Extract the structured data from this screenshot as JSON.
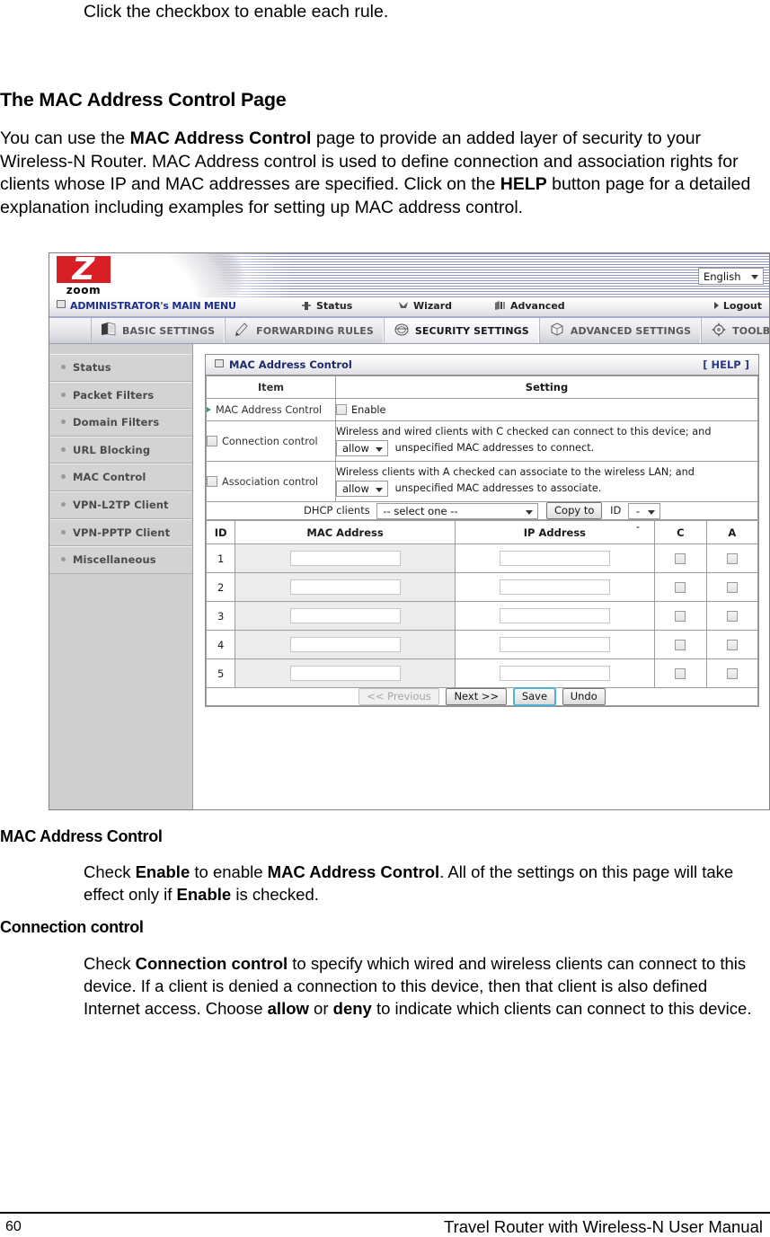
{
  "document": {
    "intro_line": "Click the checkbox to enable each rule.",
    "heading": "The MAC Address Control Page",
    "paragraph_1": "You can use the <b>MAC Address Control</b> page to provide an added layer of security to your Wireless-N Router. MAC Address control is used to define connection and association rights for clients whose IP and MAC addresses are specified. Click on the <b>HELP</b> button page for a detailed explanation including examples for setting up MAC address control.",
    "subheading_1": "MAC Address Control",
    "subparagraph_1": "Check <b>Enable</b> to enable <b>MAC Address Control</b>. All of the settings on this page will take effect only if <b>Enable</b> is checked.",
    "subheading_2": "Connection control",
    "subparagraph_2": "Check <b>Connection control</b> to specify which wired and wireless clients can connect to this device. If a client is denied a connection to this device, then that client is also defined Internet access. Choose <b>allow</b> or <b>deny</b> to indicate which clients can connect to this device.",
    "footer": {
      "page_number": "60",
      "manual_title": "Travel Router with Wireless-N User Manual"
    }
  },
  "router_ui": {
    "brand": {
      "logo_letter": "Z",
      "logo_word": "zoom"
    },
    "language": {
      "selected": "English"
    },
    "main_menu": {
      "admin_label": "ADMINISTRATOR's MAIN MENU",
      "items": [
        {
          "label": "Status",
          "icon": "status-icon"
        },
        {
          "label": "Wizard",
          "icon": "wizard-icon"
        },
        {
          "label": "Advanced",
          "icon": "advanced-icon"
        }
      ],
      "logout_label": "Logout"
    },
    "tabs": [
      {
        "label": "BASIC SETTINGS",
        "icon": "book-icon",
        "active": false
      },
      {
        "label": "FORWARDING RULES",
        "icon": "pencil-icon",
        "active": false
      },
      {
        "label": "SECURITY SETTINGS",
        "icon": "shield-icon",
        "active": true
      },
      {
        "label": "ADVANCED SETTINGS",
        "icon": "cube-icon",
        "active": false
      },
      {
        "label": "TOOLBOX",
        "icon": "toolbox-icon",
        "active": false
      }
    ],
    "sidebar": {
      "items": [
        {
          "label": "Status"
        },
        {
          "label": "Packet Filters"
        },
        {
          "label": "Domain Filters"
        },
        {
          "label": "URL Blocking"
        },
        {
          "label": "MAC Control"
        },
        {
          "label": "VPN-L2TP Client"
        },
        {
          "label": "VPN-PPTP Client"
        },
        {
          "label": "Miscellaneous"
        }
      ]
    },
    "panel": {
      "title": "MAC Address Control",
      "help_label": "[ HELP ]",
      "col_item": "Item",
      "col_setting": "Setting",
      "rows": {
        "mac_address_control": {
          "item_label": "MAC Address Control",
          "enable_label": "Enable",
          "enabled": false
        },
        "connection_control": {
          "item_label": "Connection control",
          "checked": false,
          "text_before": "Wireless and wired clients with C checked can connect to this device; and",
          "select_value": "allow",
          "text_after": "unspecified MAC addresses to connect."
        },
        "association_control": {
          "item_label": "Association control",
          "checked": false,
          "text_before": "Wireless clients with A checked can associate to the wireless LAN; and",
          "select_value": "allow",
          "text_after": "unspecified MAC addresses to associate."
        },
        "dhcp_clients": {
          "label": "DHCP clients",
          "select_value": "-- select one --",
          "copy_to_label": "Copy to",
          "id_label": "ID",
          "id_value": "--"
        }
      },
      "table": {
        "headers": [
          "ID",
          "MAC Address",
          "IP Address",
          "C",
          "A"
        ],
        "rows": [
          {
            "id": "1",
            "mac": "",
            "ip": "",
            "c": false,
            "a": false
          },
          {
            "id": "2",
            "mac": "",
            "ip": "",
            "c": false,
            "a": false
          },
          {
            "id": "3",
            "mac": "",
            "ip": "",
            "c": false,
            "a": false
          },
          {
            "id": "4",
            "mac": "",
            "ip": "",
            "c": false,
            "a": false
          },
          {
            "id": "5",
            "mac": "",
            "ip": "",
            "c": false,
            "a": false
          }
        ]
      },
      "buttons": {
        "previous": "<< Previous",
        "next": "Next >>",
        "save": "Save",
        "undo": "Undo"
      }
    },
    "colors": {
      "brand_red": "#d81f26",
      "link_navy": "#1d2b6e",
      "banner_blue": "#787cbe",
      "sidebar_gray": "#cfcfcf",
      "focus_blue": "#4fb2d8"
    }
  }
}
